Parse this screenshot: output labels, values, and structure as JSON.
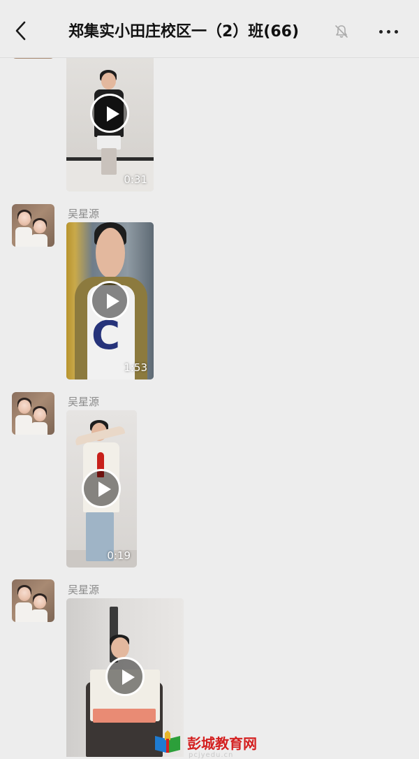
{
  "header": {
    "title": "郑集实小田庄校区一（2）班(66)",
    "muted": true
  },
  "messages": [
    {
      "sender": "",
      "type": "video",
      "duration": "0:31",
      "partial": true
    },
    {
      "sender": "吴星源",
      "type": "video",
      "duration": "1:53"
    },
    {
      "sender": "吴星源",
      "type": "video",
      "duration": "0:19"
    },
    {
      "sender": "吴星源",
      "type": "video",
      "duration": ""
    }
  ],
  "watermark": {
    "text": "彭城教育网",
    "sub": "pcjyedu.cn"
  },
  "colors": {
    "background": "#ededed",
    "sender_name": "#8a8a8a",
    "watermark_red": "#d42020"
  },
  "icons": [
    "back-arrow-icon",
    "bell-muted-icon",
    "more-dots-icon",
    "play-icon"
  ]
}
